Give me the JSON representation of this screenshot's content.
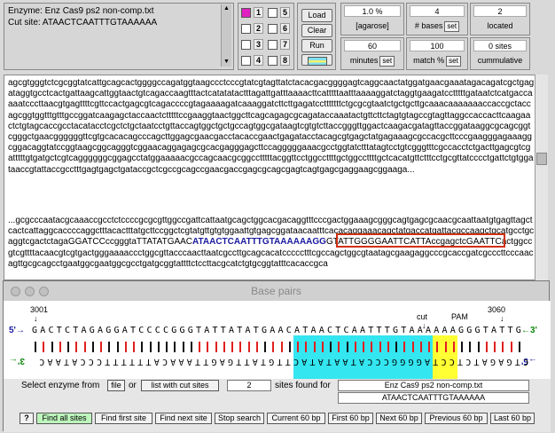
{
  "enzyme_info": {
    "enzyme_line": "Enzyme: Enz Cas9 ps2 non-comp.txt",
    "cut_site_line": "Cut site: ATAACTCAATTTGTAAAAAA"
  },
  "lanes": [
    {
      "num": "1",
      "selected": true
    },
    {
      "num": "2",
      "selected": false
    },
    {
      "num": "3",
      "selected": false
    },
    {
      "num": "4",
      "selected": false
    },
    {
      "num": "5",
      "selected": false
    },
    {
      "num": "6",
      "selected": false
    },
    {
      "num": "7",
      "selected": false
    },
    {
      "num": "8",
      "selected": false
    }
  ],
  "buttons": {
    "load": "Load",
    "clear": "Clear",
    "run": "Run"
  },
  "stats": {
    "agarose_value": "1.0 %",
    "agarose_label": "[agarose]",
    "bases_value": "4",
    "bases_label": "# bases",
    "located_value": "2",
    "located_label": "located",
    "minutes_value": "60",
    "minutes_label": "minutes",
    "match_value": "100",
    "match_label": "match %",
    "sites_value": "0 sites",
    "sites_label": "cummulative",
    "set": "set"
  },
  "sequence": {
    "block1": "agcgtgggtctcgcggtatcattgcagcactggggccagatggtaagccctcccgtatcgtagttatctacacgacggggagtcaggcaactatggatgaacgaaatagacagatcgctgagataggtgcctcactgattaagcattggtaactgtcagaccaagtttactcatatatactttagattgatttaaaacttcatttttaatttaaaaggatctaggtgaagatcctttttgataatctcatgaccaaaatcccttaacgtgagttttcgttccactgagcgtcagaccccgtagaaaagatcaaaggatcttcttgagatcctttttttctgcgcgtaatctgctgcttgcaaacaaaaaaaccaccgctaccagcggtggtttgtttgccggatcaagagctaccaactctttttccgaaggtaactggcttcagcagagcgcagataccaaatactgttcttctagtgtagccgtagttaggccaccacttcaagaactctgtagcaccgcctacatacctcgctctgctaatcctgttaccagtggctgctgccagtggcgataagtcgtgtcttaccgggttggactcaagacgatagttaccggataaggcgcagcggtcgggctgaacggggggttcgtgcacacagcccagcttggagcgaacgacctacaccgaactgagatacctacagcgtgagctatgagaaagcgccacgcttcccgaagggagaaaggcggacaggtatccggtaagcggcagggtcggaacaggagagcgcacgagggagcttccagggggaaacgcctggtatctttatagtcctgtcgggtttcgccacctctgacttgagcgtcgatttttgtgatgctcgtcaggggggcggagcctatggaaaaacgccagcaacgcggcctttttacggttcctggccttttgctggccttttgctcacatgttctttcctgcgttatcccctgattctgtggataaccgtattaccgcctttgagtgagctgataccgctcgccgcagccgaacgaccgagcgcagcgagtcagtgagcgaggaagcggaaga...",
    "block2_pre": "...gcgcccaatacgcaaaccgcctctccccgcgcgttggccgattcattaatgcagctggcacgacaggtttcccgactggaaagcgggcagtgagcgcaacgcaattaatgtgagttagctcactcattaggcaccccaggctttacactttatgcttccggctcgtatgttgtgtggaattgtgagcggataacaatttcacacaggaaacagctatgaccatgattacgccaagctgcatgcctgcaggtcgactctagaGGATCCccgggtaTTATATGAAC",
    "block2_site": "ATAACTCAATTTGTAAAAAAGG",
    "block2_post": "GTATTGGGGAATTCATTAccgagctcGAATTCactggccgtcgttttacaacgtcgtgactgggaaaaccctggcgttacccaacttaatcgccttgcagcacatccccctttcgccagctggcgtaatagcgaagaggcccgcaccgatcgcccttcccaacagttgcgcagcctgaatggcgaatggcgcctgatgcggtattttctccttacgcatctgtgcggtatttcacaccgca"
  },
  "base_pairs": {
    "title": "Base pairs",
    "start_coord": "3001",
    "end_coord": "3060",
    "cut_label": "cut",
    "pam_label": "PAM",
    "top_strand": "GACTCTAGAGGATCCCCGGGTATTATATGAACATAACTCAATTTGTAAAAAAGGGTATTG",
    "bottom_strand": "CTGAGATCTCCTAGGGGCCCATAATATACTTGTATTGAGTTAAACATTTTTTCCCATAAC",
    "left_top_label": "5'→",
    "right_top_label": "←3'",
    "left_bottom_label": "3'←",
    "right_bottom_label": "→5'"
  },
  "controls": {
    "select_label": "Select enzyme from",
    "file_btn": "file",
    "or_label": "or",
    "list_btn": "list with cut sites",
    "sites_count": "2",
    "sites_found_label": "sites found for",
    "enzyme_name": "Enz Cas9 ps2 non-comp.txt",
    "enzyme_site": "ATAACTCAATTTGTAAAAAA",
    "help": "?",
    "find_all": "Find all sites",
    "find_first": "Find first site",
    "find_next": "Find next site",
    "stop_search": "Stop search",
    "current_60": "Current 60 bp",
    "first_60": "First 60 bp",
    "next_60": "Next 60 bp",
    "previous_60": "Previous 60 bp",
    "last_60": "Last 60 bp"
  },
  "colors": {
    "cyan_highlight": "#33e6f0",
    "yellow_highlight": "#ffff33",
    "site_box": "#d03010",
    "lane_selected": "#e020c0",
    "base_A": "#e02020",
    "base_T": "#e02020",
    "base_G": "#111111",
    "base_C": "#111111"
  }
}
